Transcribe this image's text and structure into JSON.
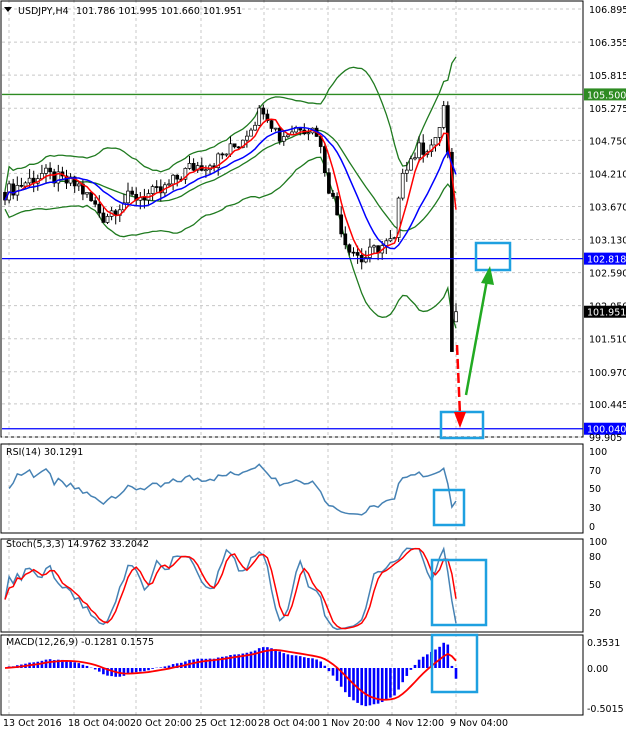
{
  "header": {
    "symbol": "USDJPY,H4",
    "ohlc": "101.786 101.995 101.660 101.951"
  },
  "chart_data": {
    "type": "candlestick",
    "title": "USDJPY,H4",
    "price_ticks": [
      "106.895",
      "106.355",
      "105.815",
      "105.275",
      "104.750",
      "104.210",
      "103.670",
      "103.130",
      "102.590",
      "102.050",
      "101.510",
      "100.970",
      "100.445",
      "99.905"
    ],
    "ylim": [
      99.905,
      106.895
    ],
    "close_keypoints": [
      [
        0,
        103.9
      ],
      [
        9,
        104.2
      ],
      [
        18,
        104.0
      ],
      [
        24,
        103.5
      ],
      [
        30,
        103.8
      ],
      [
        38,
        103.9
      ],
      [
        45,
        104.3
      ],
      [
        51,
        104.4
      ],
      [
        57,
        104.7
      ],
      [
        63,
        105.3
      ],
      [
        67,
        104.8
      ],
      [
        72,
        105.0
      ],
      [
        76,
        104.9
      ],
      [
        79,
        104.0
      ],
      [
        83,
        103.1
      ],
      [
        87,
        102.8
      ],
      [
        91,
        103.0
      ],
      [
        95,
        103.1
      ],
      [
        97,
        104.3
      ],
      [
        101,
        104.6
      ],
      [
        105,
        104.7
      ],
      [
        107,
        105.3
      ],
      [
        108,
        104.5
      ],
      [
        109,
        101.3
      ],
      [
        110,
        101.951
      ]
    ],
    "levels": [
      {
        "label": "105.500",
        "value": 105.5,
        "color": "#2e8b22"
      },
      {
        "label": "102.818",
        "value": 102.818,
        "color": "#0000ff"
      },
      {
        "label": "100.040",
        "value": 100.04,
        "color": "#0000ff"
      }
    ],
    "last_price_label": "101.951",
    "x_labels": [
      "13 Oct 2016",
      "18 Oct 04:00",
      "20 Oct 20:00",
      "25 Oct 12:00",
      "28 Oct 04:00",
      "1 Nov 20:00",
      "4 Nov 12:00",
      "9 Nov 04:00"
    ],
    "rsi": {
      "title": "RSI(14) 30.1291",
      "ticks": [
        "100",
        "70",
        "50",
        "30",
        "0"
      ]
    },
    "stoch": {
      "title": "Stoch(5,3,3) 14.9762 33.2042",
      "ticks": [
        "100",
        "80",
        "50",
        "20"
      ]
    },
    "macd": {
      "title": "MACD(12,26,9) -0.1281 0.1575",
      "ticks": [
        "0.3531",
        "0.00",
        "-0.5015"
      ]
    },
    "colors": {
      "bb": "#1f7a1f",
      "fast_ma": "#ff0000",
      "slow_ma": "#0000ff",
      "rsi": "#4682b4",
      "highlight": "#1ea0e0",
      "arrow_down": "#ff0000",
      "arrow_up": "#22aa22"
    }
  }
}
